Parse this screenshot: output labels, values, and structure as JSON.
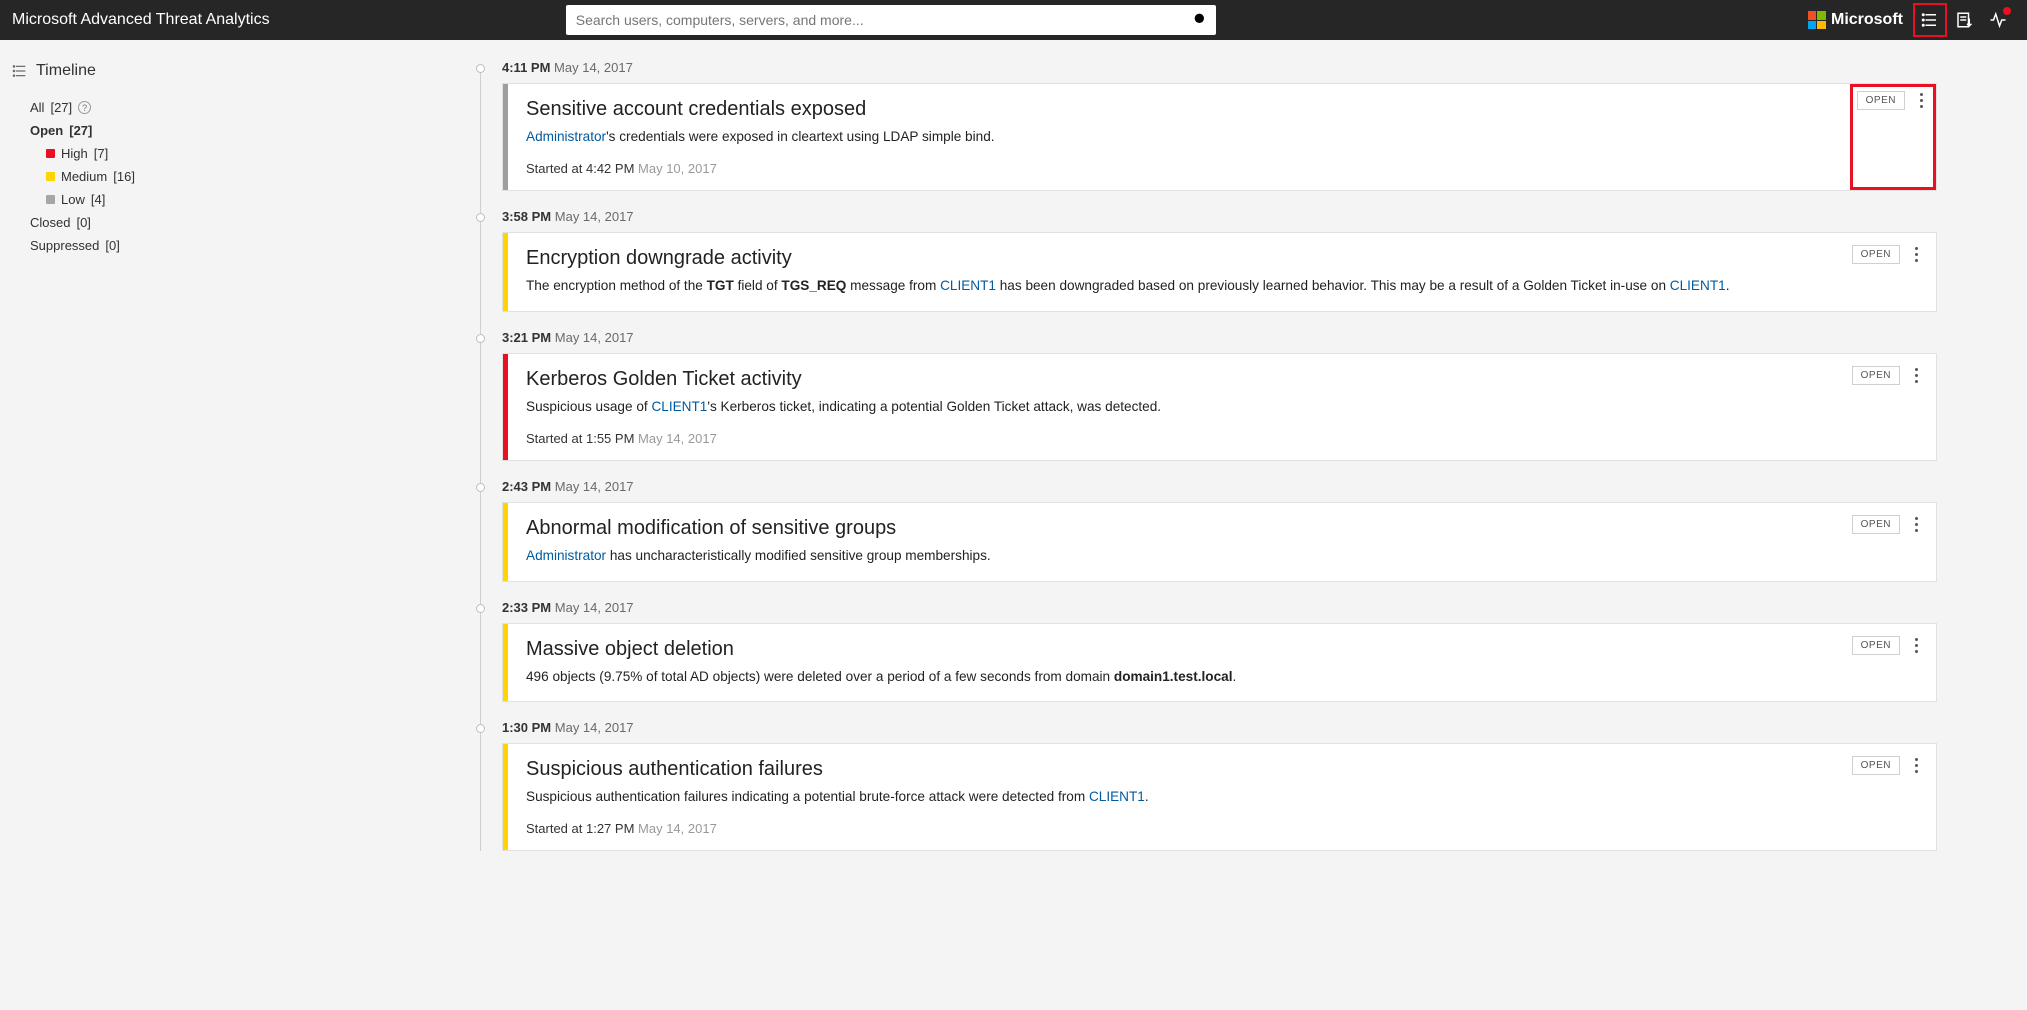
{
  "header": {
    "app_title": "Microsoft Advanced Threat Analytics",
    "search_placeholder": "Search users, computers, servers, and more...",
    "ms_brand": "Microsoft"
  },
  "sidebar": {
    "title": "Timeline",
    "filters": {
      "all": {
        "label": "All",
        "count": "[27]"
      },
      "open": {
        "label": "Open",
        "count": "[27]"
      },
      "high": {
        "label": "High",
        "count": "[7]"
      },
      "medium": {
        "label": "Medium",
        "count": "[16]"
      },
      "low": {
        "label": "Low",
        "count": "[4]"
      },
      "closed": {
        "label": "Closed",
        "count": "[0]"
      },
      "suppressed": {
        "label": "Suppressed",
        "count": "[0]"
      }
    }
  },
  "labels": {
    "open_badge": "OPEN",
    "started_prefix": "Started at "
  },
  "entries": [
    {
      "time": "4:11 PM",
      "date": "May 14, 2017",
      "sev": "gray",
      "title": "Sensitive account credentials exposed",
      "d": {
        "link1": "Administrator",
        "t1": "'s credentials were exposed in cleartext using LDAP simple bind."
      },
      "started_time": "4:42 PM",
      "started_date": "May 10, 2017",
      "highlight": true
    },
    {
      "time": "3:58 PM",
      "date": "May 14, 2017",
      "sev": "med",
      "title": "Encryption downgrade activity",
      "d": {
        "t1": "The encryption method of the ",
        "b1": "TGT",
        "t2": " field of ",
        "b2": "TGS_REQ",
        "t3": " message from ",
        "link1": "CLIENT1",
        "t4": " has been downgraded based on previously learned behavior. This may be a result of a Golden Ticket in-use on ",
        "link2": "CLIENT1",
        "t5": "."
      }
    },
    {
      "time": "3:21 PM",
      "date": "May 14, 2017",
      "sev": "high",
      "title": "Kerberos Golden Ticket activity",
      "d": {
        "t1": "Suspicious usage of ",
        "link1": "CLIENT1",
        "t2": "'s Kerberos ticket, indicating a potential Golden Ticket attack, was detected."
      },
      "started_time": "1:55 PM",
      "started_date": "May 14, 2017"
    },
    {
      "time": "2:43 PM",
      "date": "May 14, 2017",
      "sev": "med",
      "title": "Abnormal modification of sensitive groups",
      "d": {
        "link1": "Administrator",
        "t1": " has uncharacteristically modified sensitive group memberships."
      }
    },
    {
      "time": "2:33 PM",
      "date": "May 14, 2017",
      "sev": "med",
      "title": "Massive object deletion",
      "d": {
        "t1": "496 objects (9.75% of total AD objects) were deleted over a period of a few seconds from domain ",
        "b1": "domain1.test.local",
        "t2": "."
      }
    },
    {
      "time": "1:30 PM",
      "date": "May 14, 2017",
      "sev": "med",
      "title": "Suspicious authentication failures",
      "d": {
        "t1": "Suspicious authentication failures indicating a potential brute-force attack were detected from ",
        "link1": "CLIENT1",
        "t2": "."
      },
      "started_time": "1:27 PM",
      "started_date": "May 14, 2017"
    }
  ]
}
